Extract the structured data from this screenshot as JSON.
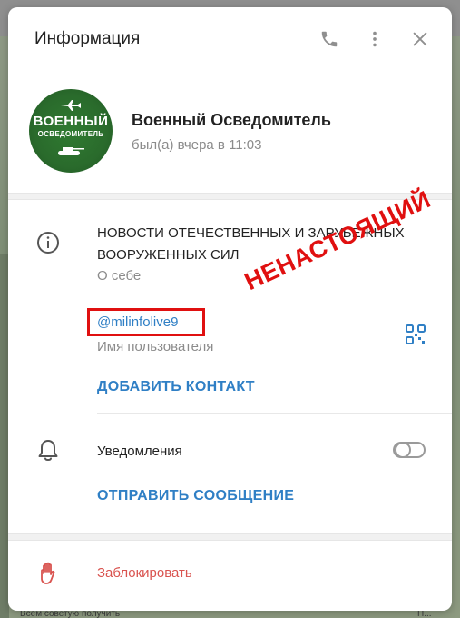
{
  "background": {
    "hint_text_left": "Всем советую получить",
    "hint_text_right": "Н..."
  },
  "dialog": {
    "title": "Информация",
    "header_icons": [
      "phone-icon",
      "more-vertical-icon",
      "close-icon"
    ]
  },
  "profile": {
    "avatar_line1": "ВОЕННЫЙ",
    "avatar_line2": "ОСВЕДОМИТЕЛЬ",
    "name": "Военный Осведомитель",
    "status": "был(а) вчера в 11:03"
  },
  "info": {
    "bio": "НОВОСТИ ОТЕЧЕСТВЕННЫХ И ЗАРУБЕЖНЫХ ВООРУЖЕННЫХ СИЛ",
    "bio_label": "О себе",
    "username": "@milinfolive9",
    "username_label": "Имя пользователя",
    "fake_stamp": "НЕНАСТОЯЩИЙ",
    "add_contact": "ДОБАВИТЬ КОНТАКТ"
  },
  "notifications": {
    "label": "Уведомления",
    "enabled": false,
    "send_message": "ОТПРАВИТЬ СООБЩЕНИЕ"
  },
  "block": {
    "label": "Заблокировать"
  },
  "colors": {
    "accent": "#2f7fc5",
    "danger": "#d9534f",
    "stamp": "#e01010",
    "avatar_green": "#2a6b2c"
  }
}
